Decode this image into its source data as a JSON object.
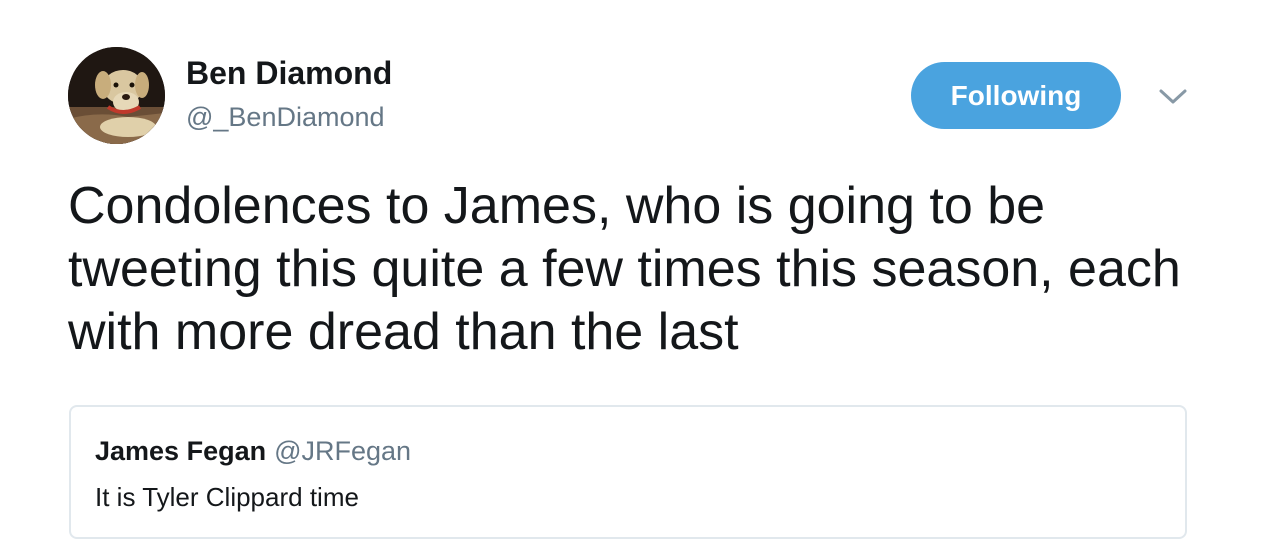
{
  "author": {
    "display_name": "Ben Diamond",
    "handle": "@_BenDiamond",
    "avatar_icon": "dog-avatar"
  },
  "follow_button": {
    "label": "Following",
    "color": "#4aa3df"
  },
  "menu_icon": "chevron-down-icon",
  "tweet": {
    "text": "Condolences to James, who is going to be tweeting this quite a few times this season, each with more dread than the last"
  },
  "quoted_tweet": {
    "display_name": "James Fegan",
    "handle": "@JRFegan",
    "text": "It is Tyler Clippard time"
  },
  "colors": {
    "text": "#14171a",
    "secondary_text": "#657786",
    "border": "#e1e8ed"
  }
}
